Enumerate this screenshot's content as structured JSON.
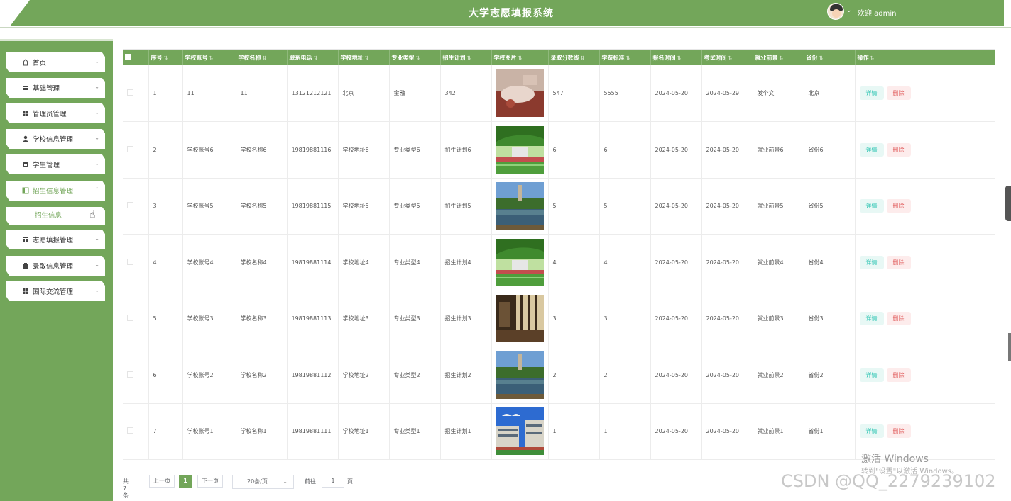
{
  "header": {
    "title": "大学志愿填报系统",
    "welcome": "欢迎 admin",
    "caret": "⌄"
  },
  "sidebar": {
    "items": [
      {
        "label": "首页",
        "icon": "home-icon"
      },
      {
        "label": "基础管理",
        "icon": "folder-icon"
      },
      {
        "label": "管理员管理",
        "icon": "grid-icon"
      },
      {
        "label": "学校信息管理",
        "icon": "user-icon"
      },
      {
        "label": "学生管理",
        "icon": "student-icon"
      },
      {
        "label": "招生信息管理",
        "icon": "panel-icon"
      },
      {
        "label": "志愿填报管理",
        "icon": "table-icon"
      },
      {
        "label": "录取信息管理",
        "icon": "box-icon"
      },
      {
        "label": "国际交流管理",
        "icon": "grid-icon"
      }
    ],
    "sub_item": "招生信息"
  },
  "table": {
    "columns": [
      "序号",
      "学校账号",
      "学校名称",
      "联系电话",
      "学校地址",
      "专业类型",
      "招生计划",
      "学校图片",
      "录取分数线",
      "学费标准",
      "报名时间",
      "考试时间",
      "就业前景",
      "省份",
      "操作"
    ],
    "rows": [
      {
        "idx": "1",
        "account": "11",
        "name": "11",
        "phone": "13121212121",
        "address": "北京",
        "major": "金融",
        "plan": "342",
        "image": "dorm-room",
        "score": "547",
        "fee": "5555",
        "signup": "2024-05-20",
        "exam": "2024-05-29",
        "prospect": "发个文",
        "province": "北京"
      },
      {
        "idx": "2",
        "account": "学校账号6",
        "name": "学校名称6",
        "phone": "19819881116",
        "address": "学校地址6",
        "major": "专业类型6",
        "plan": "招生计划6",
        "image": "campus-field",
        "score": "6",
        "fee": "6",
        "signup": "2024-05-20",
        "exam": "2024-05-20",
        "prospect": "就业前景6",
        "province": "省份6"
      },
      {
        "idx": "3",
        "account": "学校账号5",
        "name": "学校名称5",
        "phone": "19819881115",
        "address": "学校地址5",
        "major": "专业类型5",
        "plan": "招生计划5",
        "image": "lake-tower",
        "score": "5",
        "fee": "5",
        "signup": "2024-05-20",
        "exam": "2024-05-20",
        "prospect": "就业前景5",
        "province": "省份5"
      },
      {
        "idx": "4",
        "account": "学校账号4",
        "name": "学校名称4",
        "phone": "19819881114",
        "address": "学校地址4",
        "major": "专业类型4",
        "plan": "招生计划4",
        "image": "campus-field",
        "score": "4",
        "fee": "4",
        "signup": "2024-05-20",
        "exam": "2024-05-20",
        "prospect": "就业前景4",
        "province": "省份4"
      },
      {
        "idx": "5",
        "account": "学校账号3",
        "name": "学校名称3",
        "phone": "19819881113",
        "address": "学校地址3",
        "major": "专业类型3",
        "plan": "招生计划3",
        "image": "library-hall",
        "score": "3",
        "fee": "3",
        "signup": "2024-05-20",
        "exam": "2024-05-20",
        "prospect": "就业前景3",
        "province": "省份3"
      },
      {
        "idx": "6",
        "account": "学校账号2",
        "name": "学校名称2",
        "phone": "19819881112",
        "address": "学校地址2",
        "major": "专业类型2",
        "plan": "招生计划2",
        "image": "lake-tower",
        "score": "2",
        "fee": "2",
        "signup": "2024-05-20",
        "exam": "2024-05-20",
        "prospect": "就业前景2",
        "province": "省份2"
      },
      {
        "idx": "7",
        "account": "学校账号1",
        "name": "学校名称1",
        "phone": "19819881111",
        "address": "学校地址1",
        "major": "专业类型1",
        "plan": "招生计划1",
        "image": "campus-building",
        "score": "1",
        "fee": "1",
        "signup": "2024-05-20",
        "exam": "2024-05-20",
        "prospect": "就业前景1",
        "province": "省份1"
      }
    ],
    "actions": {
      "detail": "详情",
      "delete": "删除"
    }
  },
  "pagination": {
    "total": "共 7 条",
    "prev": "上一页",
    "current": "1",
    "next": "下一页",
    "page_size": "20条/页",
    "goto": "前往",
    "goto_value": "1",
    "page": "页"
  },
  "overlay": {
    "windows_activate": "激活 Windows",
    "windows_activate_sub": "转到\"设置\"以激活 Windows。",
    "watermark": "CSDN @QQ_2279239102"
  },
  "colors": {
    "primary": "#73a65a",
    "detail": "#2cc5b2",
    "delete": "#e05b5b"
  }
}
